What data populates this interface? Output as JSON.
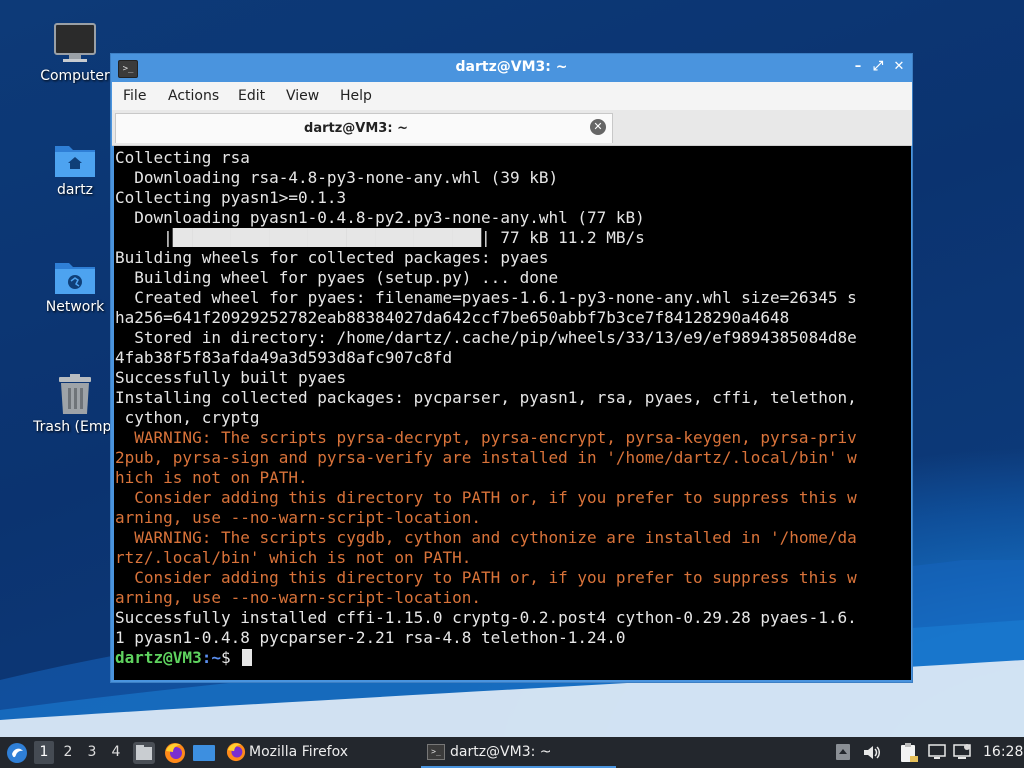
{
  "desktop": {
    "icons": [
      {
        "label": "Computer",
        "icon": "computer-icon"
      },
      {
        "label": "dartz",
        "icon": "home-folder-icon"
      },
      {
        "label": "Network",
        "icon": "network-folder-icon"
      },
      {
        "label": "Trash (Empt",
        "icon": "trash-icon"
      }
    ]
  },
  "window": {
    "title": "dartz@VM3: ~",
    "menu": [
      "File",
      "Actions",
      "Edit",
      "View",
      "Help"
    ],
    "tab_title": "dartz@VM3: ~",
    "controls": {
      "minimize": "–",
      "maximize": "⤢",
      "close": "✕"
    }
  },
  "terminal": {
    "lines": [
      {
        "text": "Collecting rsa",
        "warn": false
      },
      {
        "text": "  Downloading rsa-4.8-py3-none-any.whl (39 kB)",
        "warn": false
      },
      {
        "text": "Collecting pyasn1>=0.1.3",
        "warn": false
      },
      {
        "text": "  Downloading pyasn1-0.4.8-py2.py3-none-any.whl (77 kB)",
        "warn": false
      },
      {
        "text": "     |████████████████████████████████| 77 kB 11.2 MB/s",
        "warn": false
      },
      {
        "text": "Building wheels for collected packages: pyaes",
        "warn": false
      },
      {
        "text": "  Building wheel for pyaes (setup.py) ... done",
        "warn": false
      },
      {
        "text": "  Created wheel for pyaes: filename=pyaes-1.6.1-py3-none-any.whl size=26345 s",
        "warn": false
      },
      {
        "text": "ha256=641f20929252782eab88384027da642ccf7be650abbf7b3ce7f84128290a4648",
        "warn": false
      },
      {
        "text": "  Stored in directory: /home/dartz/.cache/pip/wheels/33/13/e9/ef9894385084d8e",
        "warn": false
      },
      {
        "text": "4fab38f5f83afda49a3d593d8afc907c8fd",
        "warn": false
      },
      {
        "text": "Successfully built pyaes",
        "warn": false
      },
      {
        "text": "Installing collected packages: pycparser, pyasn1, rsa, pyaes, cffi, telethon,",
        "warn": false
      },
      {
        "text": " cython, cryptg",
        "warn": false
      },
      {
        "text": "  WARNING: The scripts pyrsa-decrypt, pyrsa-encrypt, pyrsa-keygen, pyrsa-priv",
        "warn": true
      },
      {
        "text": "2pub, pyrsa-sign and pyrsa-verify are installed in '/home/dartz/.local/bin' w",
        "warn": true
      },
      {
        "text": "hich is not on PATH.",
        "warn": true
      },
      {
        "text": "  Consider adding this directory to PATH or, if you prefer to suppress this w",
        "warn": true
      },
      {
        "text": "arning, use --no-warn-script-location.",
        "warn": true
      },
      {
        "text": "  WARNING: The scripts cygdb, cython and cythonize are installed in '/home/da",
        "warn": true
      },
      {
        "text": "rtz/.local/bin' which is not on PATH.",
        "warn": true
      },
      {
        "text": "  Consider adding this directory to PATH or, if you prefer to suppress this w",
        "warn": true
      },
      {
        "text": "arning, use --no-warn-script-location.",
        "warn": true
      },
      {
        "text": "Successfully installed cffi-1.15.0 cryptg-0.2.post4 cython-0.29.28 pyaes-1.6.",
        "warn": false
      },
      {
        "text": "1 pyasn1-0.4.8 pycparser-2.21 rsa-4.8 telethon-1.24.0",
        "warn": false
      }
    ],
    "prompt": {
      "user": "dartz@VM3",
      "sep": ":",
      "path": "~",
      "symbol": "$ "
    }
  },
  "taskbar": {
    "workspaces": [
      "1",
      "2",
      "3",
      "4"
    ],
    "active_workspace": "1",
    "tasks": [
      {
        "label": "Mozilla Firefox",
        "icon": "firefox-icon"
      },
      {
        "label": "dartz@VM3: ~",
        "icon": "terminal-icon"
      }
    ],
    "clock": "16:28",
    "colors": {
      "accent": "#4a94de",
      "panel": "#23272d"
    }
  }
}
